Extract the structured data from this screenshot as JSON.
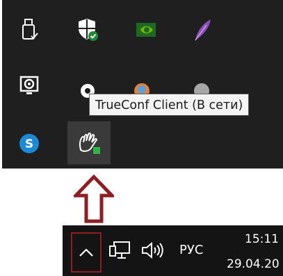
{
  "tooltip": {
    "text": "TrueConf Client (В сети)"
  },
  "tray_icons": [
    {
      "name": "usb-safely-remove-icon"
    },
    {
      "name": "windows-security-icon"
    },
    {
      "name": "nvidia-icon"
    },
    {
      "name": "feather-app-icon"
    },
    {
      "name": "display-settings-icon"
    },
    {
      "name": "cloud-app-icon"
    },
    {
      "name": "orange-app-icon"
    },
    {
      "name": "gray-app-icon"
    },
    {
      "name": "skype-icon"
    },
    {
      "name": "trueconf-client-icon"
    }
  ],
  "taskbar": {
    "language": "РУС",
    "time": "15:11",
    "date": "29.04.20"
  },
  "colors": {
    "flyout_bg": "#1f1f1f",
    "taskbar_bg": "#141414",
    "annotation": "#8f1e24",
    "trueconf_status": "#2fb34a"
  }
}
